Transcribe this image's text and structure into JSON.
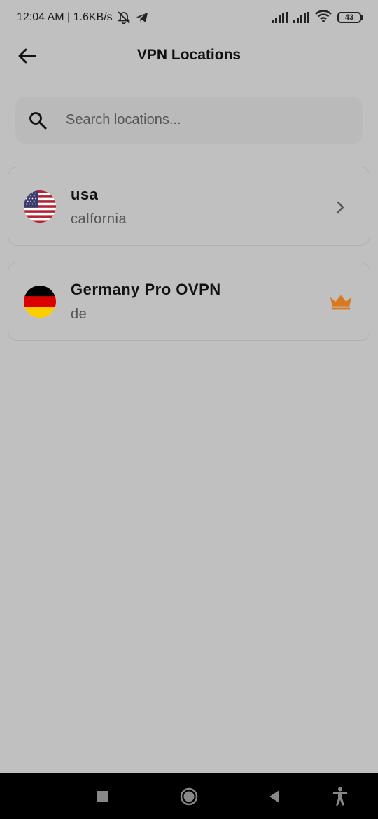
{
  "status": {
    "time_speed": "12:04 AM | 1.6KB/s",
    "battery": "43"
  },
  "header": {
    "title": "VPN Locations"
  },
  "search": {
    "placeholder": "Search locations..."
  },
  "locations": [
    {
      "name": "usa",
      "region": "calfornia",
      "flag": "us-flag",
      "trailing": "chevron-right-icon"
    },
    {
      "name": "Germany Pro OVPN",
      "region": "de",
      "flag": "de-flag",
      "trailing": "crown-icon"
    }
  ],
  "colors": {
    "background": "#c0c0c0",
    "search_bg": "#bababa",
    "crown": "#d9791f",
    "nav_bar": "#000000"
  }
}
